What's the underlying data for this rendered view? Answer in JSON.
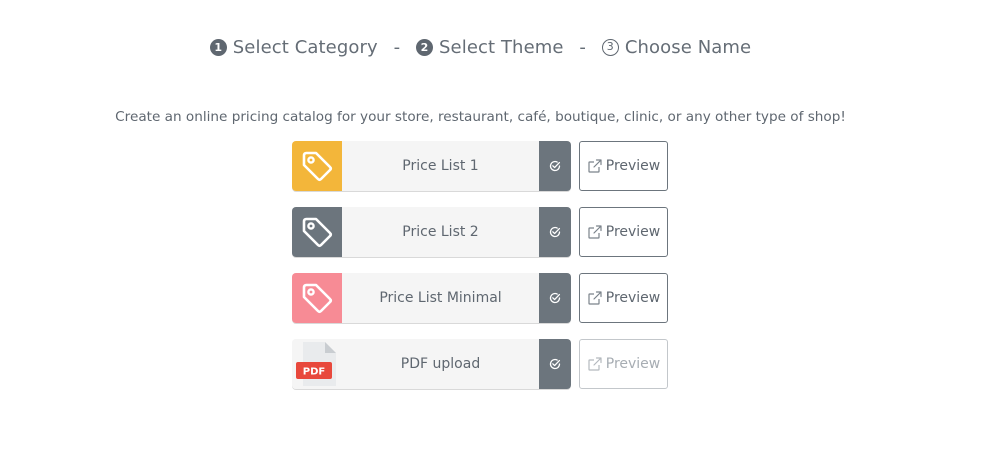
{
  "steps": [
    {
      "number": "1",
      "label": "Select Category",
      "state": "done"
    },
    {
      "number": "2",
      "label": "Select Theme",
      "state": "active"
    },
    {
      "number": "3",
      "label": "Choose Name",
      "state": "pending"
    }
  ],
  "step_separator": "-",
  "description": "Create an online pricing catalog for your store, restaurant, café, boutique, clinic, or any other type of shop!",
  "themes": [
    {
      "name": "Price List 1",
      "thumb_icon": "price-tag-icon",
      "thumb_color": "#f3b63a",
      "preview_label": "Preview",
      "preview_enabled": true
    },
    {
      "name": "Price List 2",
      "thumb_icon": "price-tag-icon",
      "thumb_color": "#6c757d",
      "preview_label": "Preview",
      "preview_enabled": true
    },
    {
      "name": "Price List Minimal",
      "thumb_icon": "price-tag-icon",
      "thumb_color": "#f78b95",
      "preview_label": "Preview",
      "preview_enabled": true
    },
    {
      "name": "PDF upload",
      "thumb_icon": "pdf-file-icon",
      "thumb_badge": "PDF",
      "thumb_color": "#f5f5f5",
      "preview_label": "Preview",
      "preview_enabled": false
    }
  ],
  "colors": {
    "select_button": "#6c757d",
    "pdf_badge": "#e8483c",
    "text": "#5f6770"
  }
}
